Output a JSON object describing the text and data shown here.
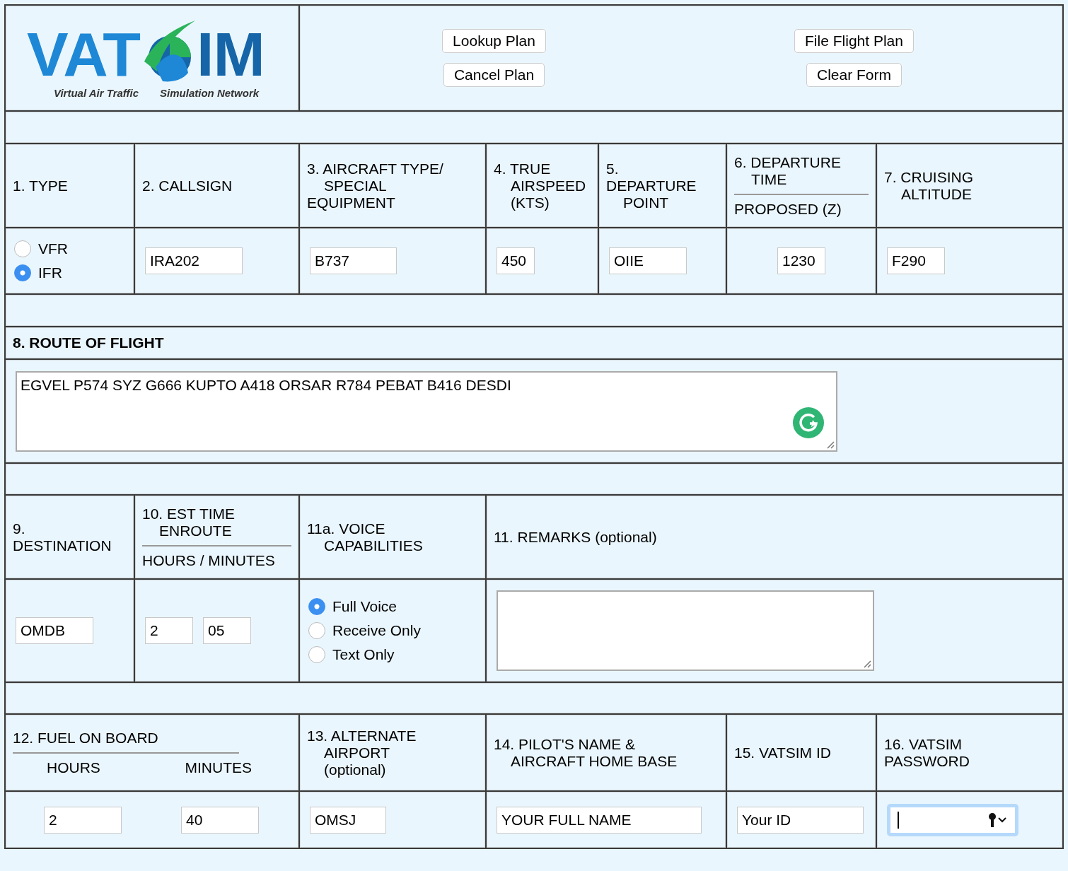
{
  "logo": {
    "letters_left": "VAT",
    "letters_right": "IM",
    "tagline_left": "Virtual Air Traffic",
    "tagline_right": "Simulation Network"
  },
  "buttons": [
    {
      "label": "Lookup Plan"
    },
    {
      "label": "File Flight Plan"
    },
    {
      "label": "Cancel Plan"
    },
    {
      "label": "Clear Form"
    }
  ],
  "section_1": {
    "labels": [
      {
        "lines": [
          {
            "t": "1. TYPE",
            "indent": false
          }
        ]
      },
      {
        "lines": [
          {
            "t": "2. CALLSIGN",
            "indent": false
          }
        ]
      },
      {
        "lines": [
          {
            "t": "3. AIRCRAFT TYPE/",
            "indent": false
          },
          {
            "t": "SPECIAL",
            "indent": true
          },
          {
            "t": "EQUIPMENT",
            "indent": false
          }
        ]
      },
      {
        "lines": [
          {
            "t": "4. TRUE",
            "indent": false
          },
          {
            "t": "AIRSPEED",
            "indent": true
          },
          {
            "t": "(KTS)",
            "indent": true
          }
        ]
      },
      {
        "lines": [
          {
            "t": "5.",
            "indent": false
          },
          {
            "t": "DEPARTURE",
            "indent": false
          },
          {
            "t": "POINT",
            "indent": true
          }
        ]
      },
      {
        "lines": [
          {
            "t": "6. DEPARTURE",
            "indent": false
          },
          {
            "t": "TIME",
            "indent": true
          }
        ],
        "sub": [
          "PROPOSED (Z)"
        ]
      },
      {
        "lines": [
          {
            "t": "7. CRUISING",
            "indent": false
          },
          {
            "t": "ALTITUDE",
            "indent": true
          }
        ]
      }
    ],
    "flight_types": [
      {
        "label": "VFR",
        "selected": false
      },
      {
        "label": "IFR",
        "selected": true
      }
    ],
    "values": [
      "IRA202",
      "B737",
      "450",
      "OIIE",
      "1230",
      "F290"
    ]
  },
  "route": {
    "heading": "8. ROUTE OF FLIGHT",
    "value": "EGVEL P574 SYZ G666 KUPTO A418 ORSAR R784 PEBAT B416 DESDI"
  },
  "section_2": {
    "labels": [
      {
        "lines": [
          {
            "t": "9.",
            "indent": false
          },
          {
            "t": "DESTINATION",
            "indent": false
          }
        ]
      },
      {
        "lines": [
          {
            "t": "10. EST TIME",
            "indent": false
          },
          {
            "t": "ENROUTE",
            "indent": true
          }
        ],
        "sub": [
          "HOURS / MINUTES"
        ]
      },
      {
        "lines": [
          {
            "t": "11a. VOICE",
            "indent": false
          },
          {
            "t": "CAPABILITIES",
            "indent": true
          }
        ]
      },
      {
        "lines": [
          {
            "t": "11. REMARKS (optional)",
            "indent": false
          }
        ]
      }
    ],
    "destination": "OMDB",
    "enroute": [
      "2",
      "05"
    ],
    "voice": [
      {
        "label": "Full Voice",
        "selected": true
      },
      {
        "label": "Receive Only",
        "selected": false
      },
      {
        "label": "Text Only",
        "selected": false
      }
    ]
  },
  "section_3": {
    "labels": [
      {
        "lines": [
          {
            "t": "12. FUEL ON BOARD",
            "indent": false
          }
        ],
        "sub": [
          "HOURS",
          "MINUTES"
        ]
      },
      {
        "lines": [
          {
            "t": "13. ALTERNATE",
            "indent": false
          },
          {
            "t": "AIRPORT",
            "indent": true
          },
          {
            "t": "(optional)",
            "indent": true
          }
        ]
      },
      {
        "lines": [
          {
            "t": "14. PILOT'S NAME &",
            "indent": false
          },
          {
            "t": "AIRCRAFT HOME BASE",
            "indent": true
          }
        ]
      },
      {
        "lines": [
          {
            "t": "15. VATSIM ID",
            "indent": false
          }
        ]
      },
      {
        "lines": [
          {
            "t": "16. VATSIM",
            "indent": false
          },
          {
            "t": "PASSWORD",
            "indent": false
          }
        ]
      }
    ],
    "fuel": [
      "2",
      "40"
    ],
    "alternate": "OMSJ",
    "pilot": "YOUR FULL NAME",
    "vatsim_id": "Your ID",
    "password": {
      "focused": true
    }
  }
}
